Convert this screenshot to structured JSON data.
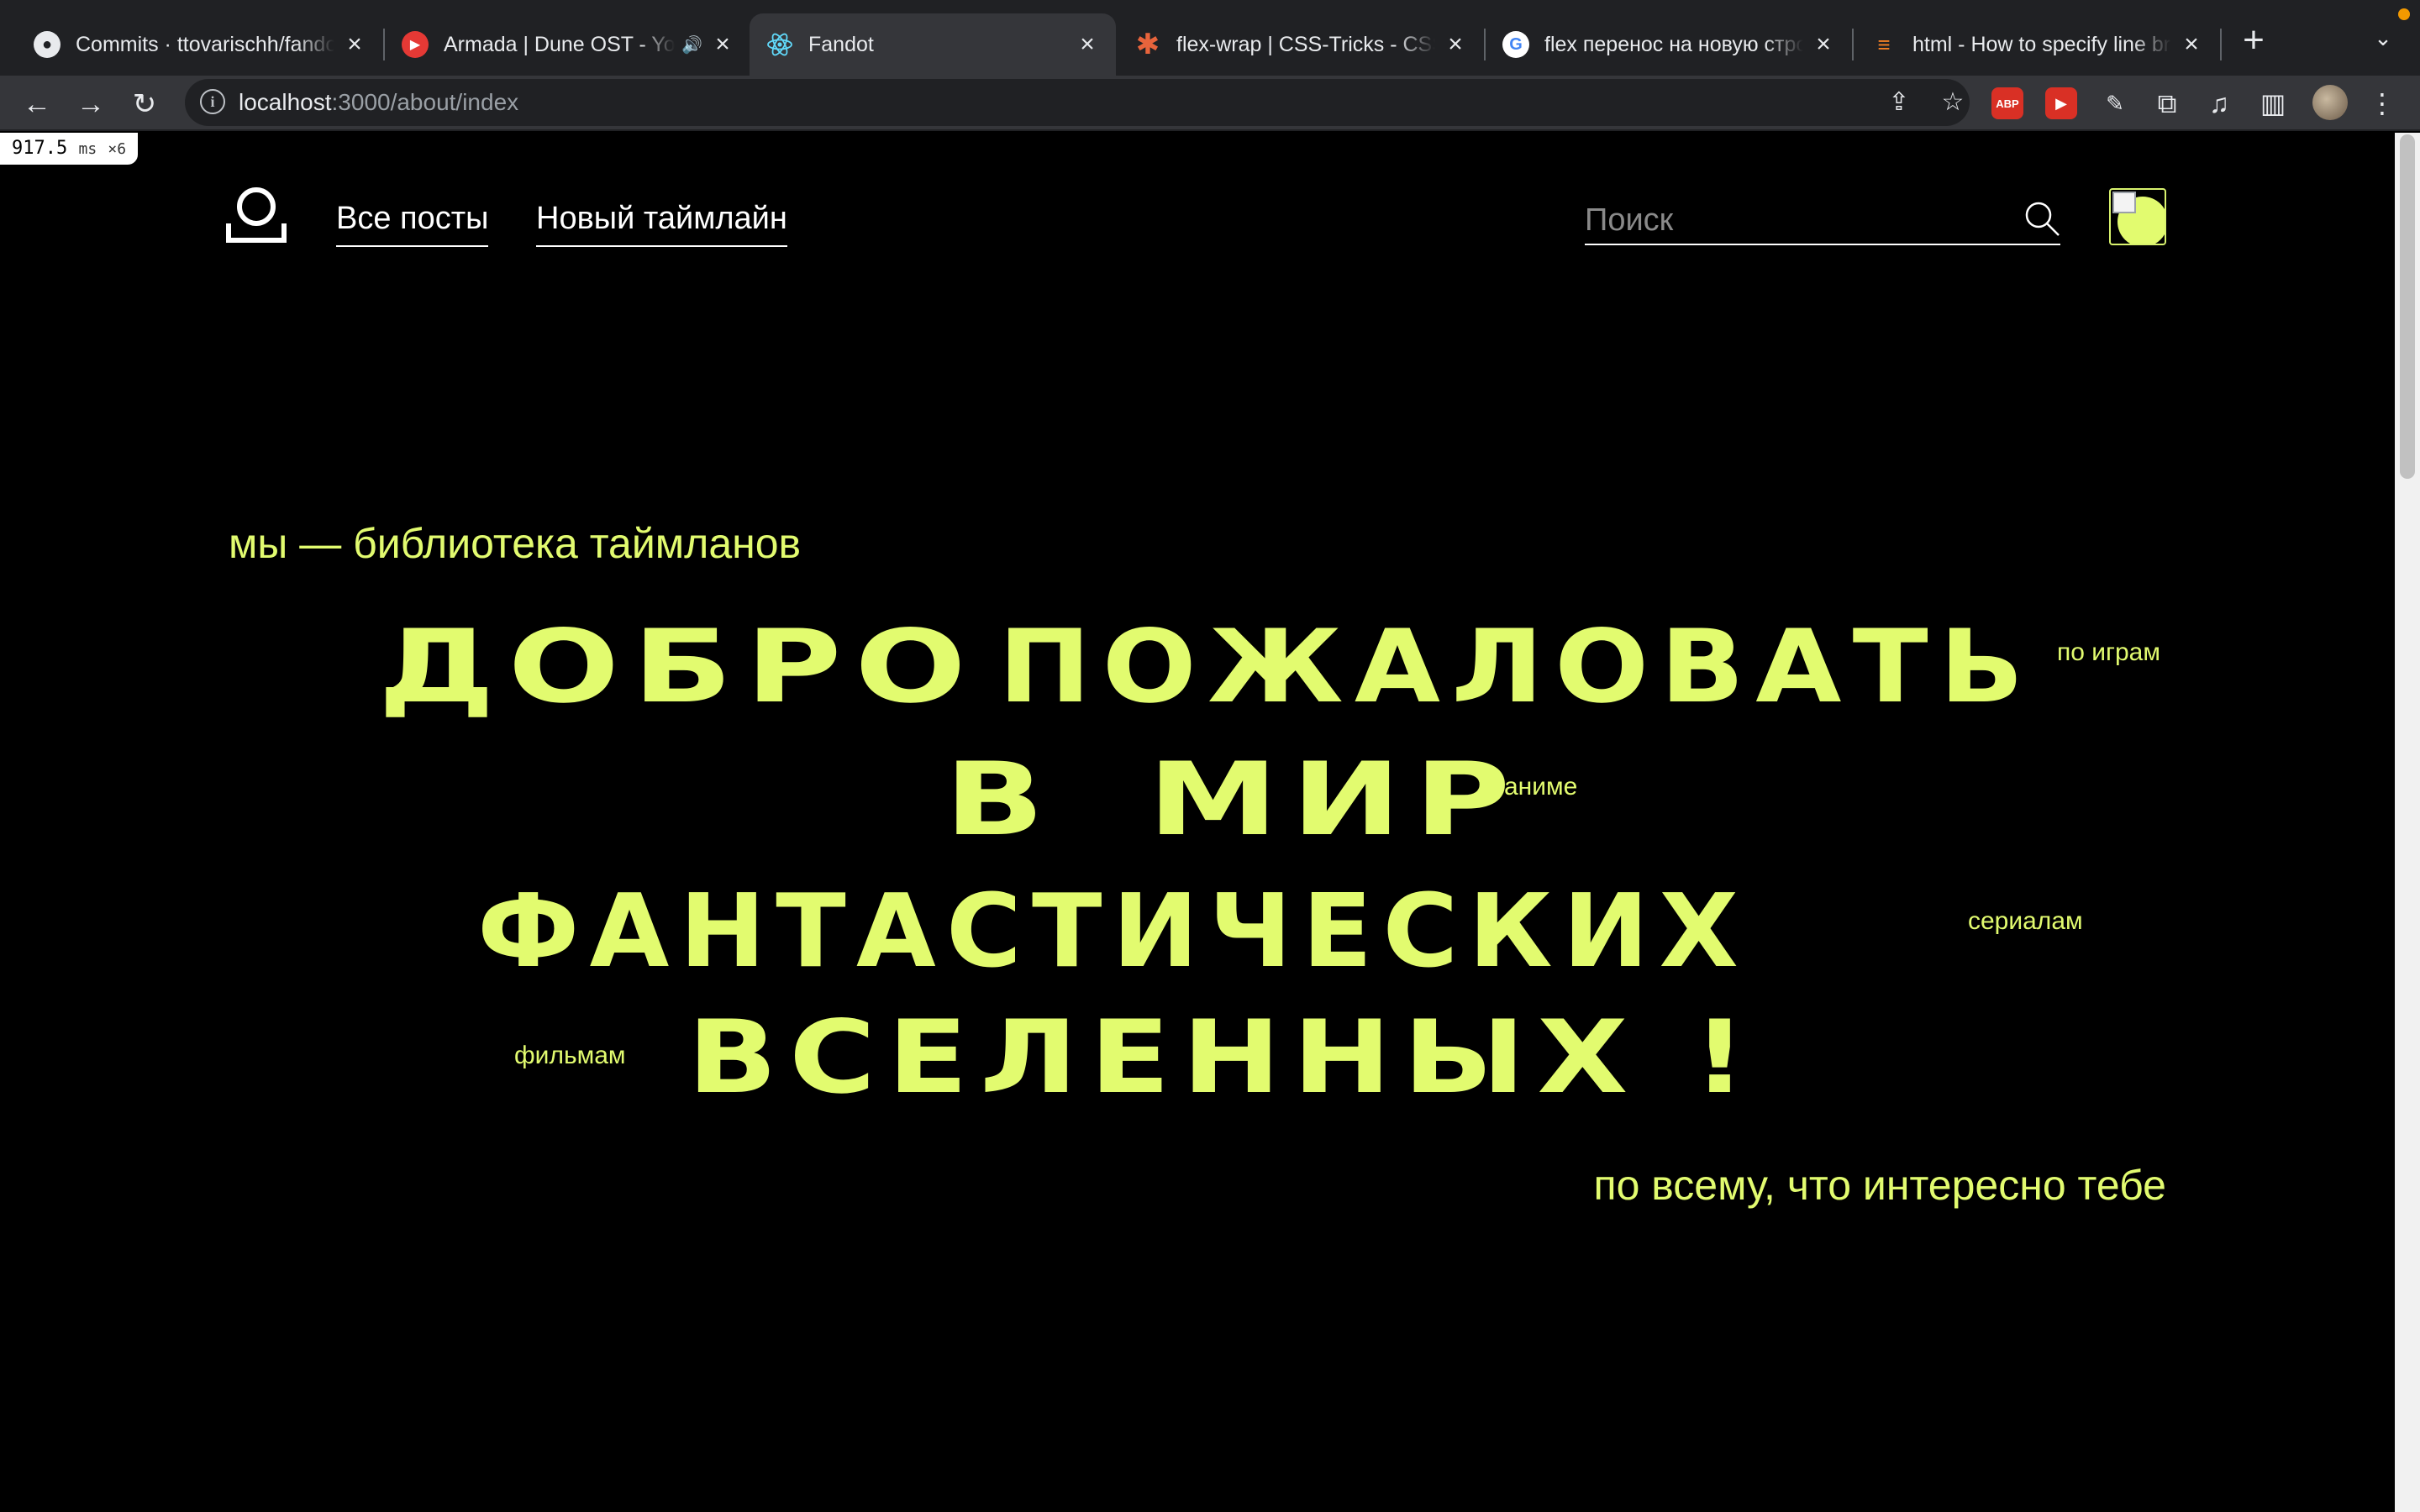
{
  "browser": {
    "tabs": [
      {
        "title": "Commits · ttovarischh/fandot",
        "icon": "github-icon"
      },
      {
        "title": "Armada | Dune OST - YouTube",
        "icon": "youtube-music-icon",
        "audio": true
      },
      {
        "title": "Fandot",
        "icon": "react-icon",
        "active": true
      },
      {
        "title": "flex-wrap | CSS-Tricks - CSS-Tricks",
        "icon": "css-tricks-icon"
      },
      {
        "title": "flex перенос на новую строку - Поиск в Google",
        "icon": "google-icon"
      },
      {
        "title": "html - How to specify line breaks",
        "icon": "stackoverflow-icon"
      }
    ],
    "url_host": "localhost",
    "url_path": ":3000/about/index",
    "extensions": [
      "ABP"
    ],
    "colors": {
      "tabstrip": "#202124",
      "toolbar": "#35363a"
    }
  },
  "perf": {
    "value": "917.5",
    "unit": "ms",
    "multiplier": "×6"
  },
  "site": {
    "nav": {
      "all_posts": "Все посты",
      "new_timeline": "Новый таймлайн"
    },
    "search": {
      "placeholder": "Поиск"
    },
    "accent": "#e2fb6f"
  },
  "hero": {
    "lead": "мы — библиотека таймланов",
    "line1a": "ДОБРО",
    "line1b": "ПОЖАЛОВАТЬ",
    "line2a": "В",
    "line2b": "МИР",
    "line3": "ФАНТАСТИЧЕСКИХ",
    "line4": "ВСЕЛЕННЫХ !",
    "tags": {
      "games": "по играм",
      "anime": "аниме",
      "series": "сериалам",
      "films": "фильмам"
    },
    "trail": "по всему, что интересно тебе"
  }
}
